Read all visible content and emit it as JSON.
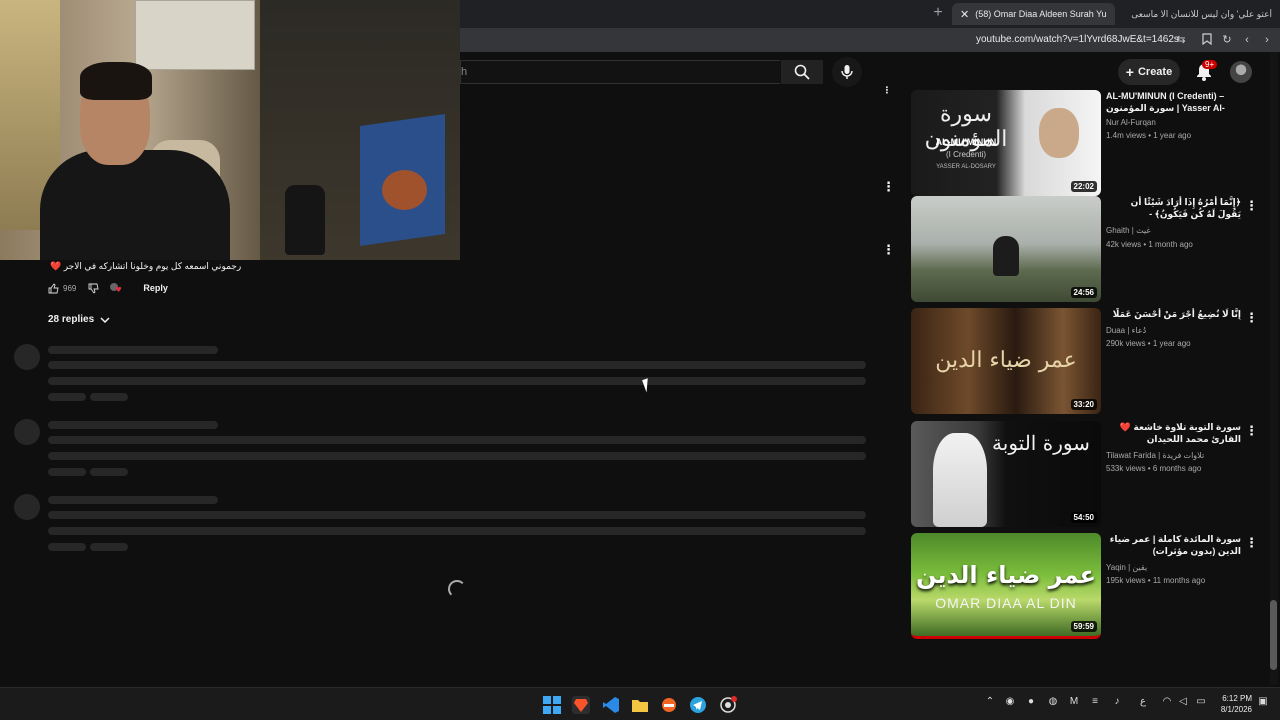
{
  "browser": {
    "tabs": [
      {
        "label": "(58) Omar Diaa Aldeen Surah Yu",
        "active": true
      },
      {
        "label": "أعتو علي' وان ليس للانسان الا ماسعى",
        "active": false
      }
    ],
    "new_tab_icon": "plus-icon",
    "url": "youtube.com/watch?v=1lYvrd68JwE&t=1462s"
  },
  "masthead": {
    "search_fragment": "h",
    "create_label": "Create",
    "notification_badge": "9+"
  },
  "comment": {
    "text": "رجموني اسمعه كل يوم وخلونا اتشاركه في الاجر ❤️",
    "like_count": "969",
    "reply_label": "Reply",
    "replies_label": "28 replies"
  },
  "recommendations": [
    {
      "title": "AL-MU'MINUN (I Credenti) – سورة المؤمنون | Yasser Al-Dosari | ...",
      "channel": "Nur Al-Furqan",
      "meta": "1.4m views • 1 year ago",
      "duration": "22:02",
      "thumb_title": "سورة المؤمنون",
      "thumb_sub": "AL-MU'MINUN",
      "thumb_sub2": "(I Credenti)",
      "thumb_reciter": "YASSER AL-DOSARY"
    },
    {
      "title": "﴿إِنَّمَا أَمْرُهُ إِذَا أَرَادَ شَيْئًا أَن يَقُولَ لَهُ كُن فَيَكُونُ﴾ -",
      "channel": "Ghaith | غيث",
      "meta": "42k views • 1 month ago",
      "duration": "24:56"
    },
    {
      "title": "إِنَّا لَا نُضِيعُ أَجْرَ مَنْ أَحْسَنَ عَمَلًا",
      "channel": "Duaa | دُعاء",
      "meta": "290k views • 1 year ago",
      "duration": "33:20",
      "thumb_title": "عمر ضياء الدين"
    },
    {
      "title": "سورة التوبة تلاوة خاشعة ❤️ القارئ محمد اللحيدان",
      "channel": "Tilawat Farida | تلاوات فريدة",
      "meta": "533k views • 6 months ago",
      "duration": "54:50",
      "thumb_title": "سورة التوبة"
    },
    {
      "title": "سورة المائدة كاملة | عمر ضياء الدين (بدون مؤثرات)",
      "channel": "Yaqin | يقين",
      "meta": "195k views • 11 months ago",
      "duration": "59:59",
      "thumb_title": "عمر ضياء الدين",
      "thumb_sub": "OMAR DIAA AL DIN"
    }
  ],
  "taskbar": {
    "time": "6:12 PM",
    "date": "8/1/2026",
    "lang": "ع"
  },
  "colors": {
    "background": "#0f0f0f",
    "accent_red": "#cc0000",
    "skeleton": "#272727"
  }
}
